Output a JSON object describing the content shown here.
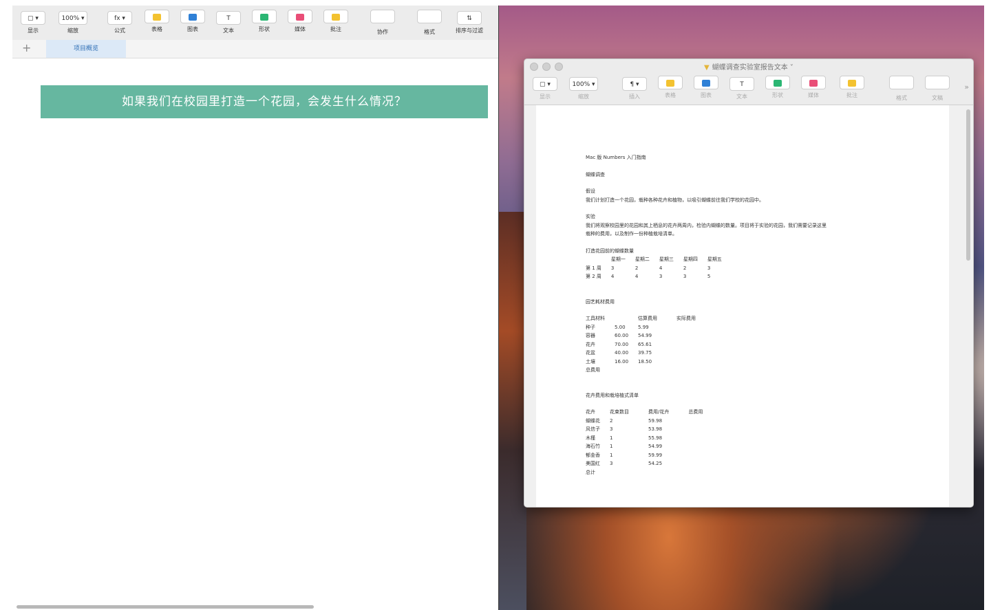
{
  "numbers": {
    "toolbar": [
      {
        "icon": "sidebar-view-icon",
        "btn": "▢ ▾",
        "label": "显示"
      },
      {
        "icon": "zoom-icon",
        "btn": "100% ▾",
        "label": "缩放"
      },
      {
        "icon": "formula-icon",
        "btn": "fx ▾",
        "label": "公式"
      },
      {
        "icon": "table-icon",
        "btn": "",
        "label": "表格",
        "color": "#f3c230"
      },
      {
        "icon": "chart-icon",
        "btn": "",
        "label": "图表",
        "color": "#2f80d6"
      },
      {
        "icon": "text-icon",
        "btn": "T",
        "label": "文本"
      },
      {
        "icon": "shape-icon",
        "btn": "",
        "label": "形状",
        "color": "#2bb673"
      },
      {
        "icon": "media-icon",
        "btn": "",
        "label": "媒体",
        "color": "#e94e77"
      },
      {
        "icon": "comment-icon",
        "btn": "",
        "label": "批注",
        "color": "#f3c230"
      },
      {
        "icon": "collaborate-icon",
        "btn": "",
        "label": "协作"
      },
      {
        "icon": "format-icon",
        "btn": "",
        "label": "格式"
      },
      {
        "icon": "sort-filter-icon",
        "btn": "⇅",
        "label": "排序与过滤"
      }
    ],
    "add_sheet": "+",
    "sheet_tab": "项目概览",
    "banner": "如果我们在校园里打造一个花园，会发生什么情况？"
  },
  "pages": {
    "title": "蝴蝶调查实验室报告文本 ˅",
    "toolbar": [
      {
        "icon": "sidebar-view-icon",
        "btn": "▢ ▾",
        "label": "显示"
      },
      {
        "icon": "zoom-icon",
        "btn": "100% ▾",
        "label": "缩放"
      },
      {
        "icon": "insert-icon",
        "btn": "¶ ▾",
        "label": "插入"
      },
      {
        "icon": "table-icon",
        "btn": "",
        "label": "表格",
        "color": "#f3c230"
      },
      {
        "icon": "chart-icon",
        "btn": "",
        "label": "图表",
        "color": "#2f80d6"
      },
      {
        "icon": "text-icon",
        "btn": "T",
        "label": "文本"
      },
      {
        "icon": "shape-icon",
        "btn": "",
        "label": "形状",
        "color": "#2bb673"
      },
      {
        "icon": "media-icon",
        "btn": "",
        "label": "媒体",
        "color": "#e94e77"
      },
      {
        "icon": "comment-icon",
        "btn": "",
        "label": "批注",
        "color": "#f3c230"
      },
      {
        "icon": "format-icon",
        "btn": "",
        "label": "格式"
      },
      {
        "icon": "document-icon",
        "btn": "",
        "label": "文稿"
      }
    ],
    "more": "»",
    "doc": {
      "heading": "Mac 版 Numbers 入门指南",
      "subheading": "蝴蝶调查",
      "hypothesis_title": "假设",
      "hypothesis": "我们计划打造一个花园，栽种各种花卉和植物，以吸引蝴蝶前往我们学校的花园中。",
      "experiment_title": "实验",
      "experiment_1": "我们将观察校园里的花园和其上栖息的花卉两周内，检验内蝴蝶的数量。项目将于实验的花园，我们需要记录这里",
      "experiment_2": "栽种的费用，以及制作一份种植栽培清单。",
      "count_title": "打造花园前的蝴蝶数量",
      "count_header": [
        "",
        "星期一",
        "星期二",
        "星期三",
        "星期四",
        "星期五"
      ],
      "count_rows": [
        [
          "第 1 周",
          "3",
          "2",
          "4",
          "2",
          "3"
        ],
        [
          "第 2 周",
          "4",
          "4",
          "3",
          "3",
          "5"
        ]
      ],
      "cost_title": "园艺耗材费用",
      "cost_header": [
        "工具材料",
        "",
        "估算费用",
        "",
        "实际费用"
      ],
      "cost_rows": [
        [
          "种子",
          "5.00",
          "5.99",
          "",
          ""
        ],
        [
          "容器",
          "60.00",
          "54.99",
          "",
          ""
        ],
        [
          "花卉",
          "70.00",
          "65.61",
          "",
          ""
        ],
        [
          "花盆",
          "40.00",
          "39.75",
          "",
          ""
        ],
        [
          "土壤",
          "16.00",
          "18.50",
          "",
          ""
        ],
        [
          "总费用",
          "",
          "",
          "",
          ""
        ]
      ],
      "flower_title": "花卉费用和栽培植式清单",
      "flower_header": [
        "花卉",
        "花束数目",
        "",
        "费用/花卉",
        "",
        "总费用"
      ],
      "flower_rows": [
        [
          "蝴蝶花",
          "2",
          "",
          "59.98",
          "",
          ""
        ],
        [
          "风信子",
          "3",
          "",
          "53.98",
          "",
          ""
        ],
        [
          "木槿",
          "1",
          "",
          "55.98",
          "",
          ""
        ],
        [
          "海石竹",
          "1",
          "",
          "54.99",
          "",
          ""
        ],
        [
          "郁金香",
          "1",
          "",
          "59.99",
          "",
          ""
        ],
        [
          "美国红",
          "3",
          "",
          "54.25",
          "",
          ""
        ],
        [
          "总计",
          "",
          "",
          "",
          "",
          ""
        ]
      ]
    }
  }
}
